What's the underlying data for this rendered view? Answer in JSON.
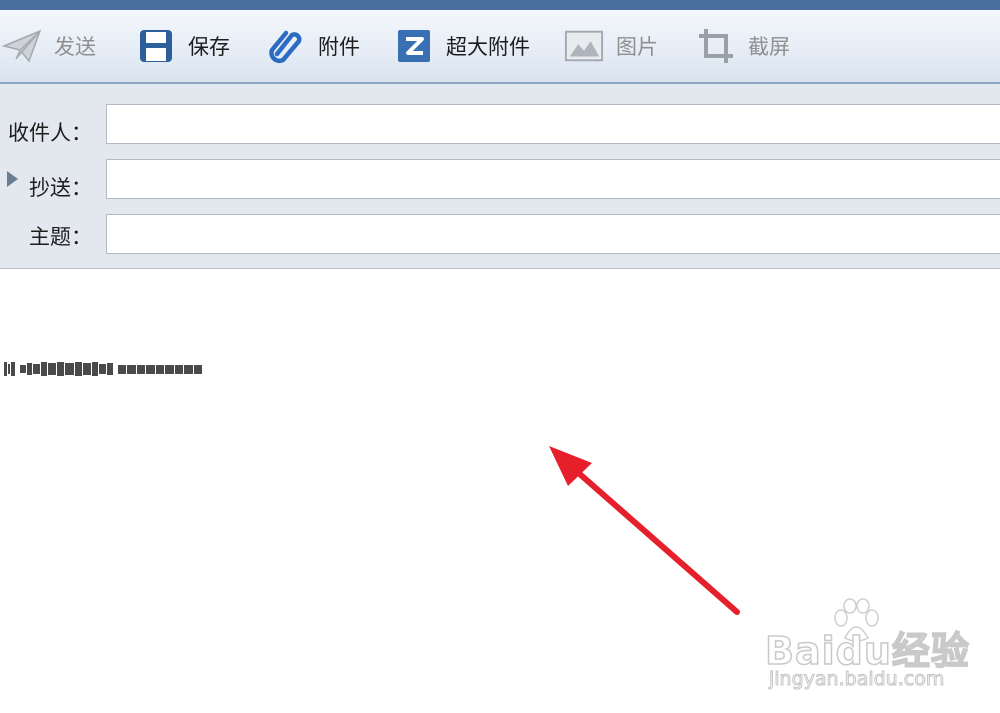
{
  "toolbar": {
    "send_label": "发送",
    "save_label": "保存",
    "attachment_label": "附件",
    "large_attachment_label": "超大附件",
    "image_label": "图片",
    "screenshot_label": "截屏"
  },
  "compose": {
    "to_label": "收件人：",
    "cc_label": "抄送：",
    "subject_label": "主题：",
    "to_value": "",
    "cc_value": "",
    "subject_value": ""
  },
  "watermark": {
    "brand": "Baidu经验",
    "url": "jingyan.baidu.com"
  },
  "colors": {
    "toolbar_top": "#4a6f9e",
    "arrow": "#e5202b",
    "header_bg": "#e3e8ee"
  },
  "icons": [
    "send-icon",
    "save-icon",
    "paperclip-icon",
    "large-attachment-icon",
    "image-icon",
    "crop-icon",
    "expand-triangle-icon"
  ]
}
